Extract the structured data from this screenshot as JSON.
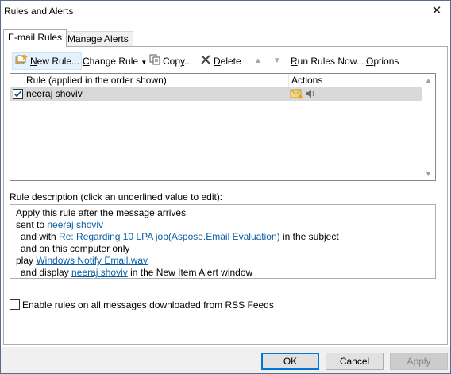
{
  "window": {
    "title": "Rules and Alerts",
    "close_glyph": "✕"
  },
  "tabs": [
    {
      "label": "E-mail Rules",
      "active": true
    },
    {
      "label": "Manage Alerts",
      "active": false
    }
  ],
  "toolbar": {
    "new_rule": {
      "accel": "N",
      "rest": "ew Rule...",
      "icon": "new-rule-icon"
    },
    "change_rule": {
      "accel": "C",
      "rest": "hange Rule",
      "icon": "dropdown-arrow-icon"
    },
    "copy": {
      "label_prefix": "Cop",
      "accel": "y",
      "rest": "...",
      "icon": "copy-icon"
    },
    "delete": {
      "accel": "D",
      "rest": "elete",
      "icon": "delete-x-icon"
    },
    "move_up_glyph": "▲",
    "move_down_glyph": "▼",
    "run_rules": {
      "accel": "R",
      "rest": "un Rules Now..."
    },
    "options": {
      "accel": "O",
      "rest": "ptions"
    }
  },
  "grid": {
    "columns": [
      "Rule (applied in the order shown)",
      "Actions"
    ],
    "rows": [
      {
        "enabled": true,
        "name": "neeraj shoviv",
        "action_icons": [
          "envelope-icon",
          "speaker-icon"
        ]
      }
    ]
  },
  "description": {
    "label": "Rule description (click an underlined value to edit):",
    "line1": "Apply this rule after the message arrives",
    "line2_prefix": "sent to ",
    "line2_link": "neeraj shoviv",
    "line3_prefix": "  and with ",
    "line3_link": "Re: Regarding 10 LPA job(Aspose.Email Evaluation)",
    "line3_suffix": " in the subject",
    "line4": "  and on this computer only",
    "line5_prefix": "play ",
    "line5_link": "Windows Notify Email.wav",
    "line6_prefix": "  and display ",
    "line6_link": "neeraj shoviv",
    "line6_suffix": " in the New Item Alert window"
  },
  "rss": {
    "label": "Enable rules on all messages downloaded from RSS Feeds",
    "checked": false
  },
  "buttons": {
    "ok": "OK",
    "cancel": "Cancel",
    "apply": "Apply"
  },
  "colors": {
    "link": "#0b5fa5",
    "selected_row": "#d9d9d9",
    "default_button_border": "#0078d7"
  }
}
